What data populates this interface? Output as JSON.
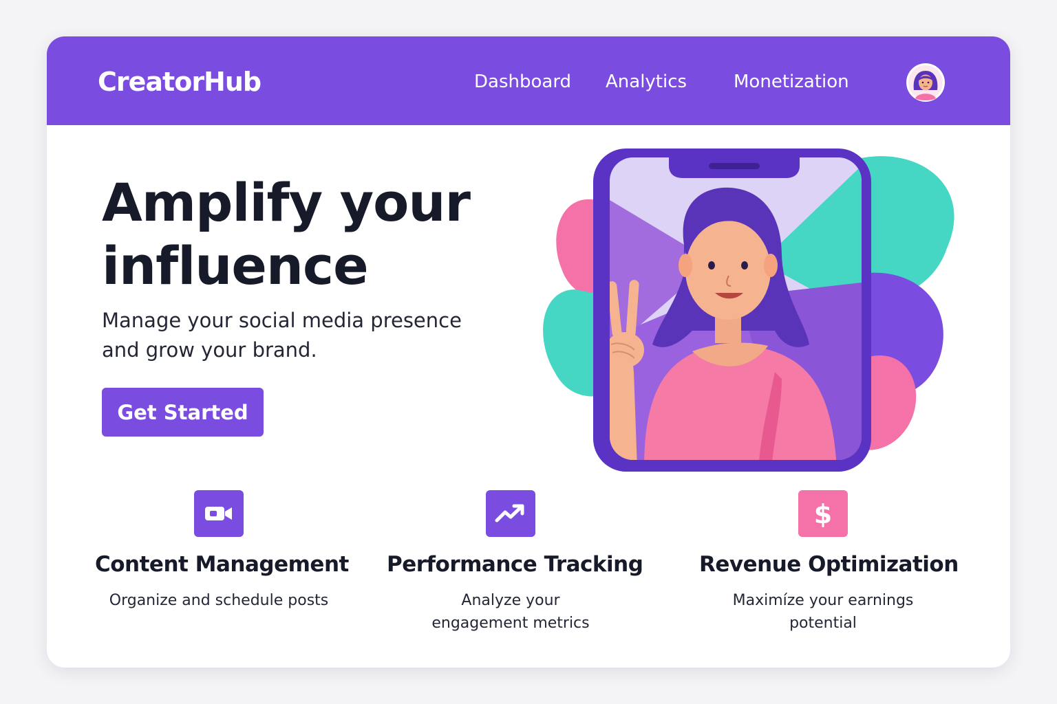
{
  "navbar": {
    "brand": "CreatorHub",
    "links": [
      "Dashboard",
      "Analytics",
      "Monetization"
    ],
    "avatar_icon": "user-avatar-icon"
  },
  "hero": {
    "title_lines": [
      "Amplify your",
      "influence"
    ],
    "subtitle_lines": [
      "Manage your social media presence",
      "and grow your brand."
    ],
    "cta_label": "Get Started"
  },
  "features": [
    {
      "icon": "video-camera-icon",
      "icon_color": "#7b4ce0",
      "title": "Content Management",
      "desc_lines": [
        "Organize and schedule posts"
      ]
    },
    {
      "icon": "trending-up-icon",
      "icon_color": "#7b4ce0",
      "title": "Performance Tracking",
      "desc_lines": [
        "Analyze your",
        "engagement metrics"
      ]
    },
    {
      "icon": "dollar-icon",
      "icon_color": "#f472a8",
      "title": "Revenue Optimization",
      "desc_lines": [
        "Maximíze your earnings",
        "potential"
      ]
    }
  ],
  "colors": {
    "primary": "#7b4ce0",
    "accent_pink": "#f472a8",
    "accent_teal": "#45d6c4",
    "text_dark": "#171a28"
  }
}
